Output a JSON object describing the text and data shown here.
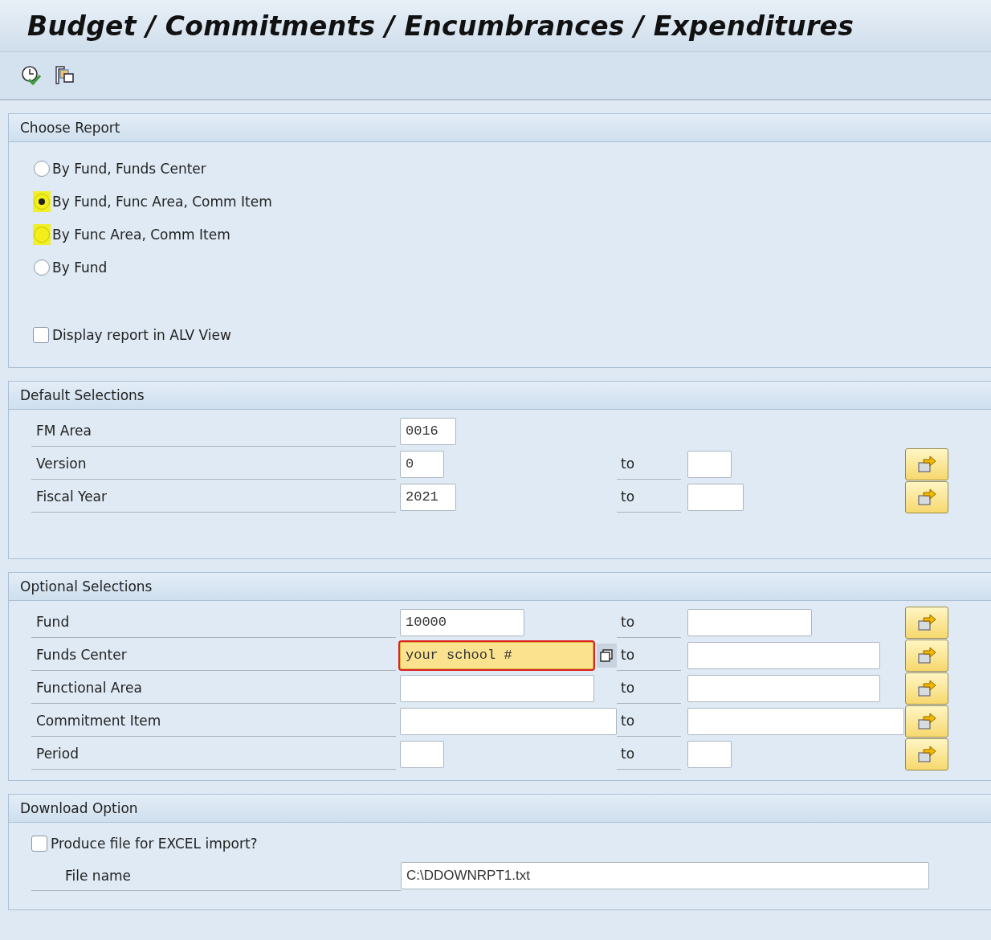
{
  "window": {
    "title": "Budget / Commitments / Encumbrances / Expenditures"
  },
  "toolbar": {
    "buttons": [
      {
        "kind": "execute"
      },
      {
        "kind": "variants"
      }
    ]
  },
  "choose_report": {
    "title": "Choose Report",
    "options": [
      {
        "label": "By Fund, Funds Center",
        "selected": false,
        "highlighted": false
      },
      {
        "label": "By Fund, Func Area, Comm Item",
        "selected": true,
        "highlighted": true
      },
      {
        "label": "By Func Area, Comm Item",
        "selected": false,
        "highlighted": true
      },
      {
        "label": "By Fund",
        "selected": false,
        "highlighted": false
      }
    ],
    "checkbox": {
      "label": "Display report in ALV View",
      "checked": false
    }
  },
  "default_selections": {
    "title": "Default Selections",
    "rows": [
      {
        "label": "FM Area",
        "value": "0016",
        "range": false
      },
      {
        "label": "Version",
        "value": "0",
        "range": true,
        "to": "to"
      },
      {
        "label": "Fiscal Year",
        "value": "2021",
        "range": true,
        "to": "to"
      }
    ]
  },
  "optional_selections": {
    "title": "Optional Selections",
    "rows": [
      {
        "label": "Fund",
        "value": "10000",
        "range": true,
        "to": "to",
        "focused": false
      },
      {
        "label": "Funds Center",
        "value": "your school #",
        "range": true,
        "to": "to",
        "focused": true
      },
      {
        "label": "Functional Area",
        "range": true,
        "to": "to",
        "focused": false
      },
      {
        "label": "Commitment Item",
        "range": true,
        "to": "to",
        "focused": false
      },
      {
        "label": "Period",
        "range": true,
        "to": "to",
        "focused": false
      }
    ]
  },
  "download_option": {
    "title": "Download Option",
    "checkbox": {
      "label": "Produce file for EXCEL import?",
      "checked": false
    },
    "file_name": {
      "label": "File name",
      "value": "C:\\DDOWNRPT1.txt"
    }
  }
}
